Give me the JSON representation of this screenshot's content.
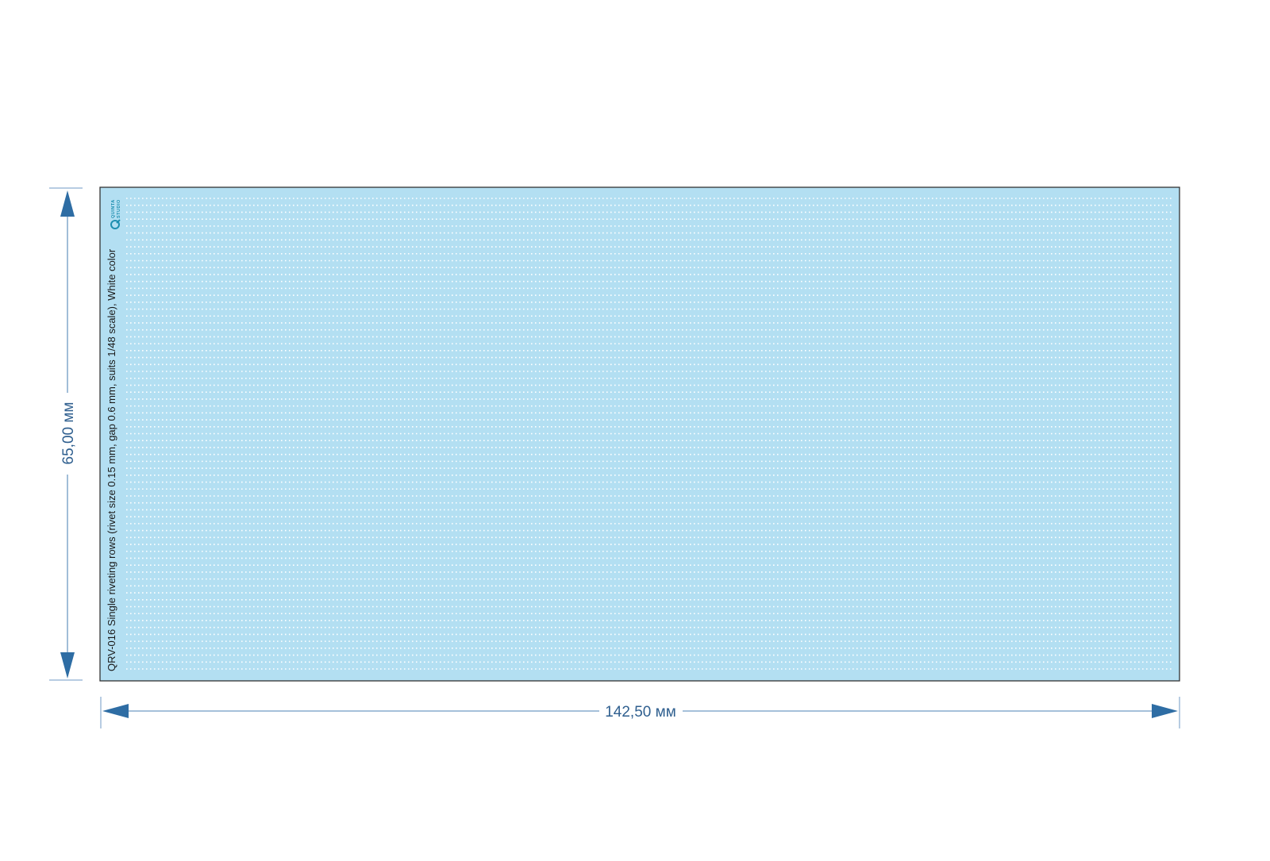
{
  "sheet": {
    "caption": "QRV-016 Single riveting rows (rivet size 0.15 mm, gap 0.6 mm, suits 1/48 scale), White color",
    "background_color": "#b3dff2",
    "rivet_color": "#ffffff",
    "border_color": "#333333",
    "logo": {
      "line1": "QUINTA",
      "line2": "STUDIO",
      "icon": "quinta-studio-logo-icon"
    }
  },
  "dimensions": {
    "width_label": "142,50 мм",
    "height_label": "65,00 мм",
    "line_color": "#6f9ac4",
    "arrow_color": "#2e6da4",
    "label_color": "#2f5f8f"
  },
  "rivet_rows": {
    "count": 69
  }
}
